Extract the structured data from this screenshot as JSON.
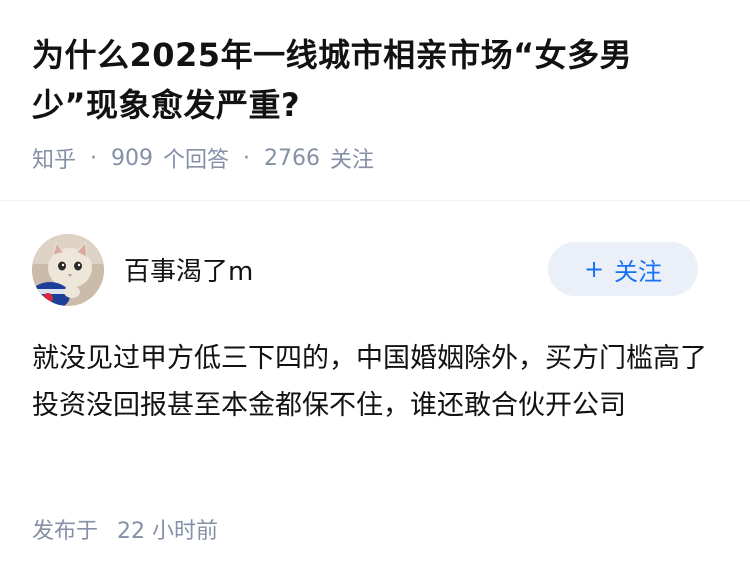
{
  "question": {
    "title": "为什么2025年一线城市相亲市场“女多男少”现象愈发严重?",
    "source": "知乎",
    "answer_count": "909",
    "answer_count_label": "个回答",
    "follow_count": "2766",
    "follow_count_label": "关注"
  },
  "answer": {
    "author_name": "百事渴了m",
    "follow_button_label": "关注",
    "follow_button_icon": "plus-icon",
    "content": "就没见过甲方低三下四的，中国婚姻除外，买方门槛高了 投资没回报甚至本金都保不住，谁还敢合伙开公司",
    "published_label": "发布于",
    "published_time": "22 小时前"
  },
  "colors": {
    "title": "#121212",
    "meta": "#8590a6",
    "accent": "#1772f6",
    "follow_button_bg": "#ebf0f8"
  }
}
